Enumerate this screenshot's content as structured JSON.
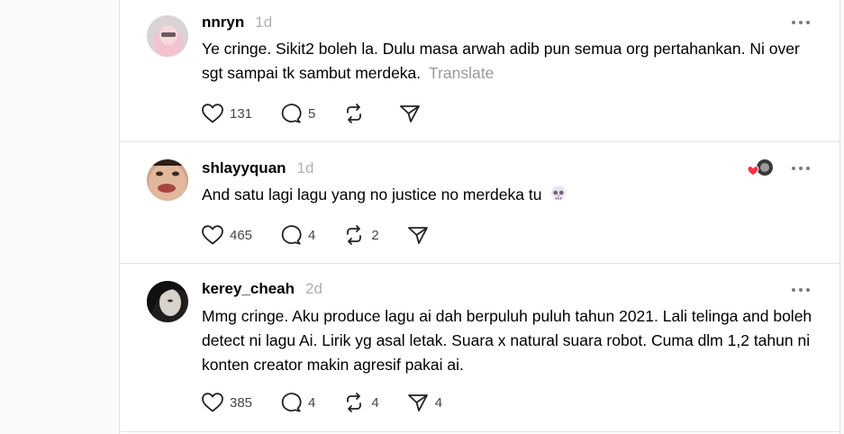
{
  "posts": [
    {
      "username": "nnryn",
      "time": "1d",
      "body": "Ye cringe. Sikit2 boleh la. Dulu masa arwah adib pun semua org pertahankan. Ni over sgt sampai tk sambut merdeka.",
      "translate": "Translate",
      "likes": "131",
      "replies": "5",
      "reposts": "",
      "shares": ""
    },
    {
      "username": "shlayyquan",
      "time": "1d",
      "body": "And satu lagi lagu yang no justice no merdeka tu",
      "emoji": "skull-emoji",
      "likes": "465",
      "replies": "4",
      "reposts": "2",
      "shares": ""
    },
    {
      "username": "kerey_cheah",
      "time": "2d",
      "body": "Mmg cringe. Aku produce lagu ai dah berpuluh puluh tahun 2021. Lali telinga and boleh detect ni lagu Ai. Lirik yg asal letak. Suara x natural suara robot. Cuma dlm 1,2 tahun ni konten creator makin agresif pakai ai.",
      "likes": "385",
      "replies": "4",
      "reposts": "4",
      "shares": "4"
    }
  ],
  "icons": {
    "like": "heart-icon",
    "reply": "comment-icon",
    "repost": "repost-icon",
    "share": "send-icon",
    "more": "more-dots-icon",
    "reaction": "liked-by-author-badge"
  },
  "colors": {
    "accent_heart": "#ff3040",
    "muted": "#b0b0b0",
    "border": "#e2e2e2"
  }
}
